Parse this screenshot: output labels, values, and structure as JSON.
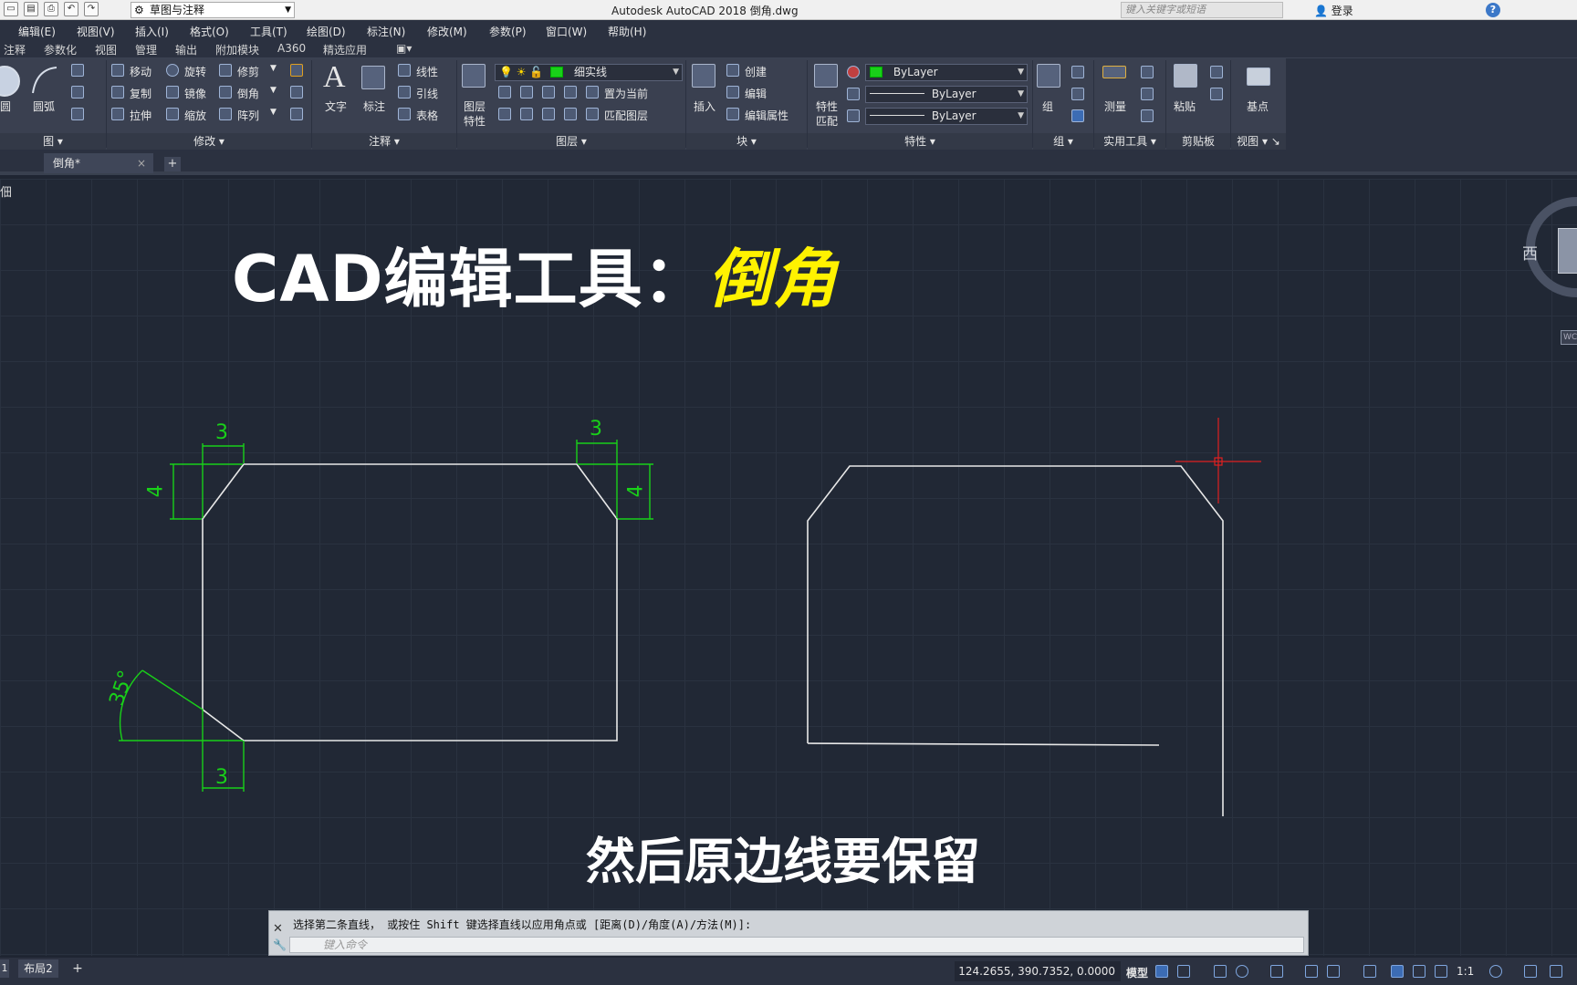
{
  "titlebar": {
    "workspace": "草图与注释",
    "app_title": "Autodesk AutoCAD 2018    倒角.dwg",
    "search_placeholder": "键入关键字或短语",
    "login": "登录",
    "help": "?"
  },
  "menu": {
    "items": [
      "编辑(E)",
      "视图(V)",
      "插入(I)",
      "格式(O)",
      "工具(T)",
      "绘图(D)",
      "标注(N)",
      "修改(M)",
      "参数(P)",
      "窗口(W)",
      "帮助(H)"
    ]
  },
  "ribbon_tabs": {
    "items": [
      "注释",
      "参数化",
      "视图",
      "管理",
      "输出",
      "附加模块",
      "A360",
      "精选应用"
    ]
  },
  "ribbon": {
    "draw": {
      "circle": "圆",
      "arc": "圆弧",
      "panel": "图"
    },
    "modify": {
      "move": "移动",
      "rotate": "旋转",
      "trim": "修剪",
      "copy": "复制",
      "mirror": "镜像",
      "chamfer": "倒角",
      "stretch": "拉伸",
      "scale": "缩放",
      "array": "阵列",
      "panel": "修改"
    },
    "annotation": {
      "text": "文字",
      "dimension": "标注",
      "linear": "线性",
      "leader": "引线",
      "table": "表格",
      "panel": "注释"
    },
    "layers": {
      "layer_props": "图层\n特性",
      "layer_props_line1": "图层",
      "layer_props_line2": "特性",
      "current_layer": "细实线",
      "set_current": "置为当前",
      "match_layer": "匹配图层",
      "panel": "图层"
    },
    "block": {
      "insert": "插入",
      "create": "创建",
      "edit": "编辑",
      "edit_attr": "编辑属性",
      "panel": "块"
    },
    "properties": {
      "match_line1": "特性",
      "match_line2": "匹配",
      "color": "ByLayer",
      "linetype": "ByLayer",
      "lineweight": "ByLayer",
      "panel": "特性"
    },
    "groups": {
      "group": "组",
      "panel": "组"
    },
    "utilities": {
      "measure": "测量",
      "panel": "实用工具"
    },
    "clipboard": {
      "paste": "粘贴",
      "panel": "剪贴板"
    },
    "view": {
      "base": "基点",
      "panel": "视图"
    }
  },
  "file_tabs": {
    "active": "倒角*",
    "close": "×",
    "new": "+"
  },
  "canvas": {
    "viewport_label": "佃",
    "headline_main": "CAD编辑工具：",
    "headline_highlight": "倒角",
    "subtitle": "然后原边线要保留",
    "dims": {
      "top_left_h": "3",
      "top_left_v": "4",
      "top_right_h": "3",
      "top_right_v": "4",
      "angle": "35°",
      "bottom_h": "3"
    },
    "viewcube_west": "西",
    "viewcube_wcs": "WC"
  },
  "colors": {
    "canvas_bg": "#212835",
    "geometry": "#e8e8e8",
    "dimension": "#19d019",
    "crosshair": "#e02020",
    "headline_highlight": "#fff200"
  },
  "command": {
    "history": "选择第二条直线， 或按住 Shift 键选择直线以应用角点或 [距离(D)/角度(A)/方法(M)]:",
    "placeholder": "键入命令"
  },
  "status": {
    "layout1": "1",
    "layout2": "布局2",
    "add": "+",
    "coords": "124.2655, 390.7352, 0.0000",
    "model": "模型",
    "scale": "1:1"
  }
}
